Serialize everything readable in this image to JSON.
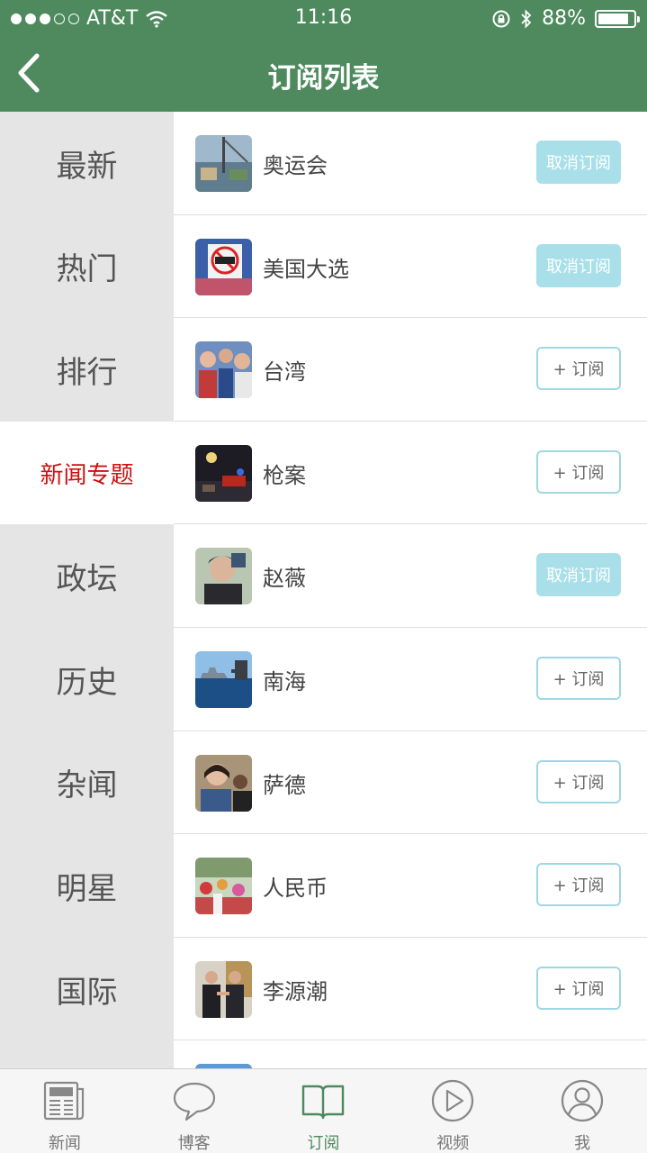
{
  "status_bar": {
    "carrier": "AT&T",
    "time": "11:16",
    "battery": "88%",
    "battery_level": 0.88,
    "signal_bars": 3
  },
  "header": {
    "title": "订阅列表"
  },
  "sidebar": {
    "items": [
      {
        "label": "最新"
      },
      {
        "label": "热门"
      },
      {
        "label": "排行"
      },
      {
        "label": "新闻专题",
        "active": true
      },
      {
        "label": "政坛"
      },
      {
        "label": "历史"
      },
      {
        "label": "杂闻"
      },
      {
        "label": "明星"
      },
      {
        "label": "国际"
      }
    ]
  },
  "subscriptions": {
    "items": [
      {
        "name": "奥运会",
        "button": "取消订阅",
        "subscribed": true
      },
      {
        "name": "美国大选",
        "button": "取消订阅",
        "subscribed": true
      },
      {
        "name": "台湾",
        "button": "+ 订阅",
        "subscribed": false
      },
      {
        "name": "枪案",
        "button": "+ 订阅",
        "subscribed": false
      },
      {
        "name": "赵薇",
        "button": "取消订阅",
        "subscribed": true
      },
      {
        "name": "南海",
        "button": "+ 订阅",
        "subscribed": false
      },
      {
        "name": "萨德",
        "button": "+ 订阅",
        "subscribed": false
      },
      {
        "name": "人民币",
        "button": "+ 订阅",
        "subscribed": false
      },
      {
        "name": "李源潮",
        "button": "+ 订阅",
        "subscribed": false
      }
    ]
  },
  "tabbar": {
    "items": [
      {
        "label": "新闻",
        "icon": "newspaper-icon"
      },
      {
        "label": "博客",
        "icon": "chat-bubble-icon"
      },
      {
        "label": "订阅",
        "icon": "open-book-icon",
        "active": true
      },
      {
        "label": "视频",
        "icon": "play-circle-icon"
      },
      {
        "label": "我",
        "icon": "user-icon"
      }
    ]
  },
  "colors": {
    "header": "#4e8a5e",
    "active_sidebar_text": "#cc1111",
    "subscribe_border": "#9fd8e3",
    "unsubscribe_fill": "#a9dfe9"
  }
}
